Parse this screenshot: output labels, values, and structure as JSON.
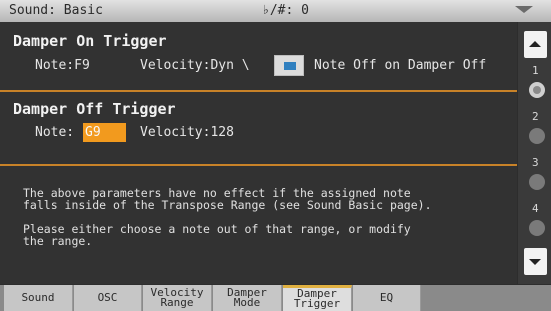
{
  "header": {
    "title": "Sound: Basic",
    "transpose": "♭/#: 0"
  },
  "damper_on": {
    "title": "Damper On Trigger",
    "note_label": "Note:",
    "note_value": "F9",
    "velocity_label": "Velocity:",
    "velocity_value": "Dyn \\",
    "checkbox_label": "Note Off on Damper Off",
    "checkbox_checked": true
  },
  "damper_off": {
    "title": "Damper Off Trigger",
    "note_label": "Note:",
    "note_value": "G9",
    "velocity_label": "Velocity:",
    "velocity_value": "128"
  },
  "message": {
    "line1": "The above parameters have no effect if the assigned note",
    "line2": "falls inside of the Transpose Range (see Sound Basic page).",
    "line3": "Please either choose a note out of that range, or modify",
    "line4": "the range."
  },
  "scroll": {
    "pages": [
      "1",
      "2",
      "3",
      "4"
    ],
    "active_page": 1
  },
  "tabs": [
    {
      "label": "Sound",
      "label2": ""
    },
    {
      "label": "OSC",
      "label2": ""
    },
    {
      "label": "Velocity",
      "label2": "Range"
    },
    {
      "label": "Damper",
      "label2": "Mode"
    },
    {
      "label": "Damper",
      "label2": "Trigger"
    },
    {
      "label": "EQ",
      "label2": ""
    }
  ],
  "selected_tab": 4,
  "colors": {
    "accent_orange": "#f29a1e",
    "section_divider": "#c88228",
    "checkbox_fill": "#2f7fbf",
    "tab_highlight": "#e0b040"
  }
}
